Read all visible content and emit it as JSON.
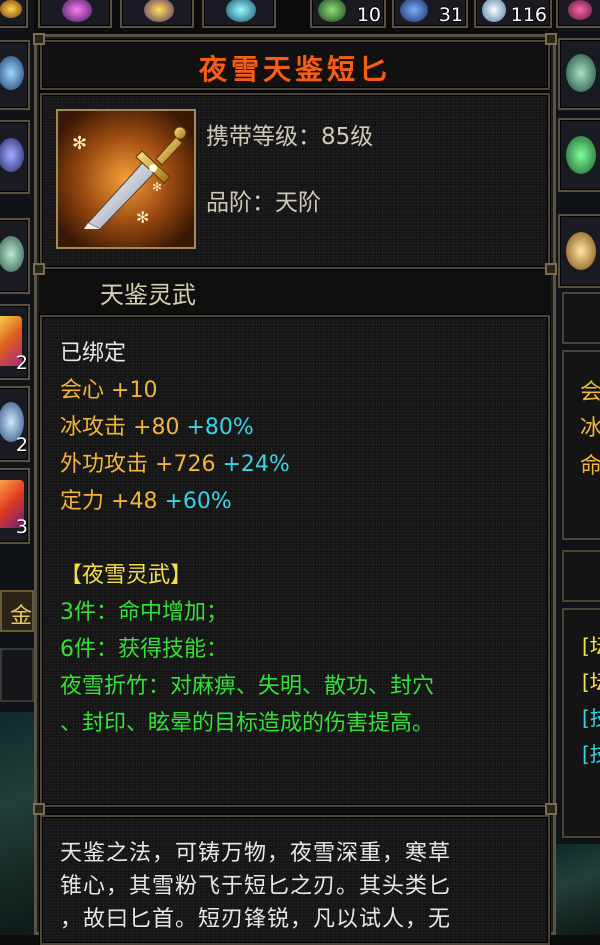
{
  "item": {
    "name": "夜雪天鉴短匕",
    "carry_level": "携带等级：85级",
    "grade": "品阶：天阶",
    "category": "天鉴灵武"
  },
  "stats": {
    "bound": "已绑定",
    "crit_label": "会心",
    "crit_value": "+10",
    "ice_label": "冰攻击",
    "ice_value": "+80",
    "ice_pct": "+80%",
    "ext_label": "外功攻击",
    "ext_value": "+726",
    "ext_pct": "+24%",
    "focus_label": "定力",
    "focus_value": "+48",
    "focus_pct": "+60%"
  },
  "set": {
    "name": "【夜雪灵武】",
    "piece3": "3件：命中增加；",
    "piece6": "6件：获得技能：",
    "skill_line1": "夜雪折竹：对麻痹、失明、散功、封穴",
    "skill_line2": "、封印、眩晕的目标造成的伤害提高。"
  },
  "description": {
    "line1": "天鉴之法，可铸万物，夜雪深重，寒草",
    "line2": "锥心，其雪粉飞于短匕之刃。其头类匕",
    "line3": "，故曰匕首。短刃锋锐，凡以试人，无"
  },
  "inventory": {
    "top_counts": [
      "10",
      "31",
      "116"
    ],
    "left_counts": [
      "2",
      "2",
      "3"
    ],
    "left_label": "金",
    "right_chars": [
      "会",
      "冰",
      "命"
    ],
    "right_brackets": [
      "[坛",
      "[坛",
      "[技",
      "[技"
    ]
  },
  "colors": {
    "title": "#f25f18",
    "gold": "#f0b53a",
    "cyan": "#39d3e6",
    "green": "#35e03a",
    "yellow": "#f6e04a"
  }
}
